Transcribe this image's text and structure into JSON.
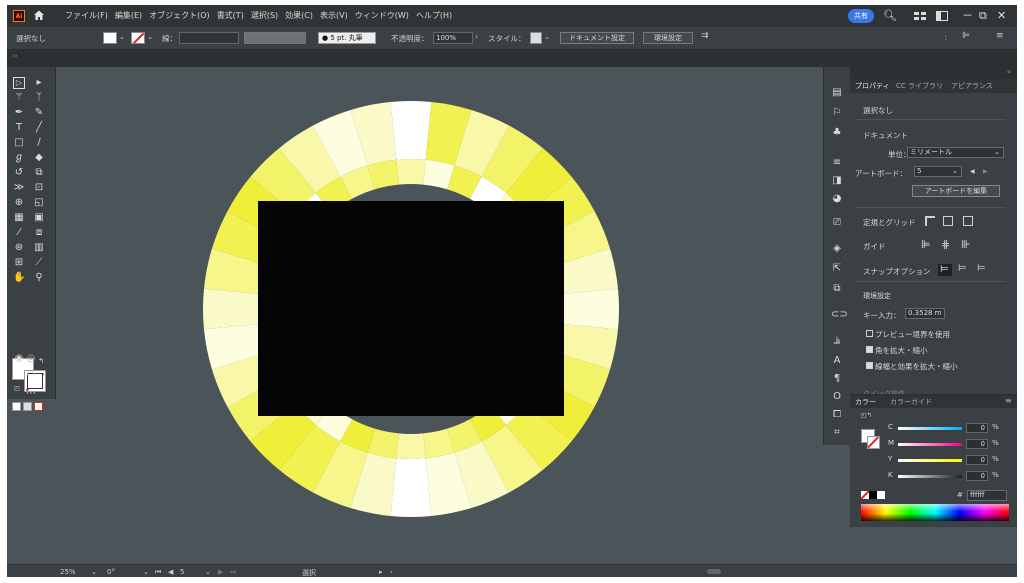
{
  "menubar": {
    "logo": "Ai",
    "items": [
      "ファイル(F)",
      "編集(E)",
      "オブジェクト(O)",
      "書式(T)",
      "選択(S)",
      "効果(C)",
      "表示(V)",
      "ウィンドウ(W)",
      "ヘルプ(H)"
    ],
    "share_label": "共有",
    "window_controls": [
      "－",
      "⧉",
      "✕"
    ]
  },
  "controlbar": {
    "selection": "選択なし",
    "stroke_label": "線：",
    "brush_label": "5 pt. 丸筆",
    "opacity_label": "不透明度：",
    "opacity_value": "100%",
    "style_label": "スタイル：",
    "doc_settings": "ドキュメント設定",
    "preferences": "環境設定"
  },
  "properties": {
    "tabs": [
      "プロパティ",
      "CC ライブラリ",
      "アピアランス"
    ],
    "selection": "選択なし",
    "document_header": "ドキュメント",
    "units_label": "単位：",
    "units_value": "ミリメートル",
    "artboard_label": "アートボード：",
    "artboard_value": "5",
    "edit_artboards": "アートボードを編集",
    "rulers_grids": "定規とグリッド",
    "guides": "ガイド",
    "snap_options": "スナップオプション",
    "prefs_header": "環境設定",
    "key_increment_label": "キー入力：",
    "key_increment_value": "0.3528 m",
    "preview_bounds": "プレビュー境界を使用",
    "scale_corners": "角を拡大・縮小",
    "scale_strokes": "線幅と効果を拡大・縮小",
    "quick_actions": "クイック操作"
  },
  "color_panel": {
    "tabs": [
      "カラー",
      "カラーガイド"
    ],
    "channels": [
      {
        "label": "C",
        "value": "0",
        "color": "#00aeef"
      },
      {
        "label": "M",
        "value": "0",
        "color": "#ec008c"
      },
      {
        "label": "Y",
        "value": "0",
        "color": "#fff200"
      },
      {
        "label": "K",
        "value": "0",
        "color": "#231f20"
      }
    ],
    "unit": "%",
    "hex_prefix": "#",
    "hex_value": "ffffff"
  },
  "statusbar": {
    "zoom": "25%",
    "rotation": "0°",
    "artboard": "5",
    "tool": "選択"
  },
  "canvas": {
    "colors": {
      "background": "#4b5559",
      "rect": "#050505",
      "ring_palette": [
        "#ffffff",
        "#fdfde0",
        "#fafac8",
        "#f8f8a8",
        "#f6f68a",
        "#f3f36a",
        "#f1f150",
        "#efef3a"
      ]
    }
  }
}
